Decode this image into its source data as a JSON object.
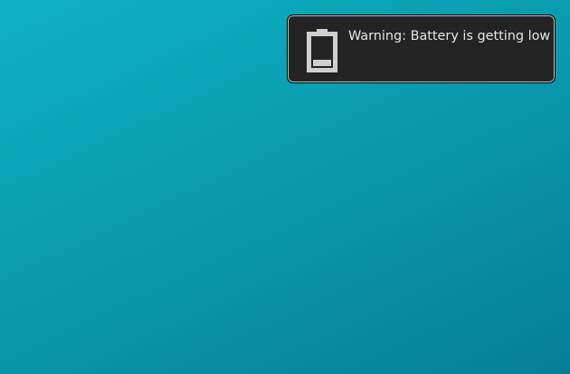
{
  "desktop": {
    "background_colors": [
      "#0fb2c3",
      "#0a9bb0",
      "#067e9b"
    ]
  },
  "notification": {
    "icon": "battery-low-icon",
    "message": "Warning: Battery is getting low",
    "background_color": "#242424",
    "text_color": "#e6e6e6",
    "icon_color": "#cfcfcf"
  }
}
